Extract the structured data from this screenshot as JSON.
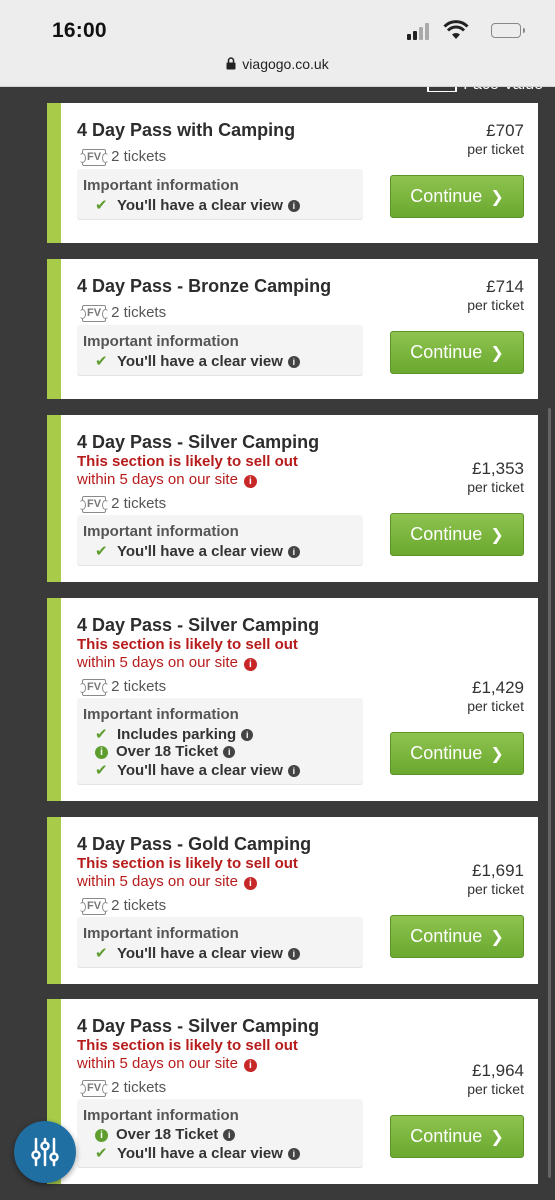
{
  "status_bar": {
    "time": "16:00"
  },
  "browser": {
    "url": "viagogo.co.uk"
  },
  "top_partial_label": "Face Value",
  "listings": [
    {
      "title": "4 Day Pass with Camping",
      "warning_line1": "",
      "warning_line2": "",
      "fv_label": "FV",
      "tickets": "2 tickets",
      "info_title": "Important information",
      "features": [
        {
          "text": "You'll have a clear view",
          "icon": "check-icon"
        }
      ],
      "price": "£707",
      "per": "per ticket",
      "button": "Continue"
    },
    {
      "title": "4 Day Pass - Bronze Camping",
      "warning_line1": "",
      "warning_line2": "",
      "fv_label": "FV",
      "tickets": "2 tickets",
      "info_title": "Important information",
      "features": [
        {
          "text": "You'll have a clear view",
          "icon": "check-icon"
        }
      ],
      "price": "£714",
      "per": "per ticket",
      "button": "Continue"
    },
    {
      "title": "4 Day Pass - Silver Camping",
      "warning_line1": "This section is likely to sell out",
      "warning_line2": "within 5 days on our site",
      "fv_label": "FV",
      "tickets": "2 tickets",
      "info_title": "Important information",
      "features": [
        {
          "text": "You'll have a clear view",
          "icon": "check-icon"
        }
      ],
      "price": "£1,353",
      "per": "per ticket",
      "button": "Continue"
    },
    {
      "title": "4 Day Pass - Silver Camping",
      "warning_line1": "This section is likely to sell out",
      "warning_line2": "within 5 days on our site",
      "fv_label": "FV",
      "tickets": "2 tickets",
      "info_title": "Important information",
      "features": [
        {
          "text": "Includes parking",
          "icon": "check-icon"
        },
        {
          "text": "Over 18 Ticket",
          "icon": "info-icon"
        },
        {
          "text": "You'll have a clear view",
          "icon": "check-icon"
        }
      ],
      "price": "£1,429",
      "per": "per ticket",
      "button": "Continue"
    },
    {
      "title": "4 Day Pass - Gold Camping",
      "warning_line1": "This section is likely to sell out",
      "warning_line2": "within 5 days on our site",
      "fv_label": "FV",
      "tickets": "2 tickets",
      "info_title": "Important information",
      "features": [
        {
          "text": "You'll have a clear view",
          "icon": "check-icon"
        }
      ],
      "price": "£1,691",
      "per": "per ticket",
      "button": "Continue"
    },
    {
      "title": "4 Day Pass - Silver Camping",
      "warning_line1": "This section is likely to sell out",
      "warning_line2": "within 5 days on our site",
      "fv_label": "FV",
      "tickets": "2 tickets",
      "info_title": "Important information",
      "features": [
        {
          "text": "Over 18 Ticket",
          "icon": "info-icon"
        },
        {
          "text": "You'll have a clear view",
          "icon": "check-icon"
        }
      ],
      "price": "£1,964",
      "per": "per ticket",
      "button": "Continue"
    }
  ],
  "colors": {
    "accent_green": "#a8cc4a",
    "button_green": "#6aa82f",
    "warning_red": "#b71c1c",
    "fab_blue": "#1f6fa3"
  }
}
